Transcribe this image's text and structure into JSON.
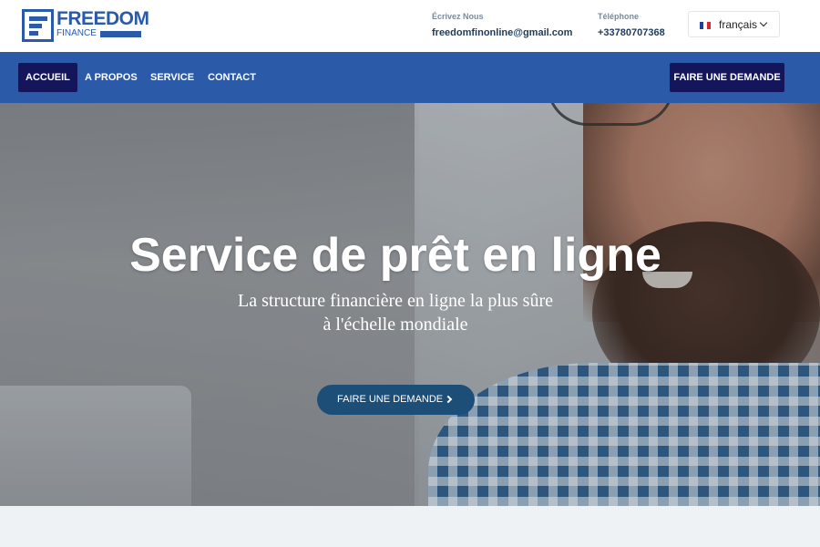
{
  "brand": {
    "name": "FREEDOM",
    "sub": "FINANCE"
  },
  "contact": {
    "email_label": "Écrivez Nous",
    "email": "freedomfinonline@gmail.com",
    "phone_label": "Téléphone",
    "phone": "+33780707368"
  },
  "language": {
    "selected": "français",
    "flag": "fr-flag-icon"
  },
  "nav": {
    "items": [
      {
        "label": "ACCUEIL"
      },
      {
        "label": "A PROPOS"
      },
      {
        "label": "SERVICE"
      },
      {
        "label": "CONTACT"
      }
    ],
    "cta": "FAIRE UNE DEMANDE"
  },
  "hero": {
    "title": "Service de prêt en ligne",
    "subtitle_line1": "La structure financière en ligne la plus sûre",
    "subtitle_line2": "à l'échelle mondiale",
    "cta": "FAIRE UNE DEMANDE",
    "cta_icon": "chevron-right-icon"
  },
  "colors": {
    "primary": "#2a5aa8",
    "dark_navy": "#15155c",
    "hero_button": "#1d4e78",
    "page_bg": "#eef2f4"
  }
}
